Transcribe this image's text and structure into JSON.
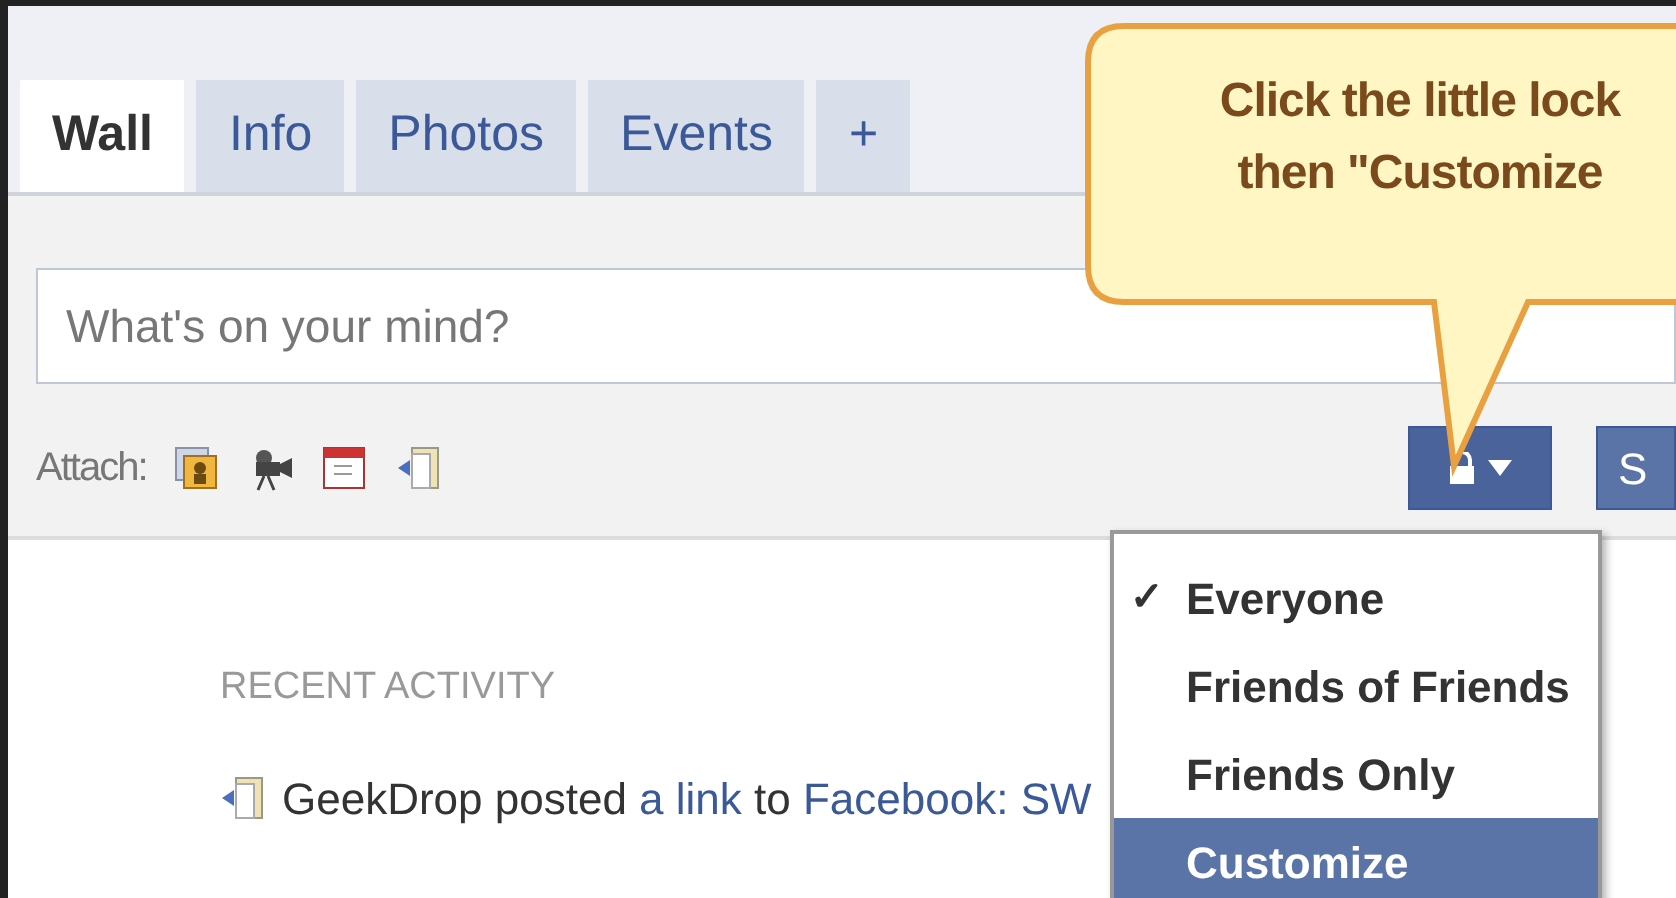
{
  "tabs": [
    {
      "label": "Wall",
      "selected": true
    },
    {
      "label": "Info",
      "selected": false
    },
    {
      "label": "Photos",
      "selected": false
    },
    {
      "label": "Events",
      "selected": false
    },
    {
      "label": "+",
      "selected": false
    }
  ],
  "composer": {
    "placeholder": "What's on your mind?",
    "attach_label": "Attach:",
    "privacy_button": {
      "expanded": true
    },
    "share_button": "S"
  },
  "callout": {
    "lines": [
      "Click the little lock",
      "then \"Customize"
    ]
  },
  "privacy_menu": [
    {
      "label": "Everyone",
      "checked": true,
      "selected": false
    },
    {
      "label": "Friends of Friends",
      "checked": false,
      "selected": false
    },
    {
      "label": "Friends Only",
      "checked": false,
      "selected": false
    },
    {
      "label": "Customize",
      "checked": false,
      "selected": true
    }
  ],
  "check_mark": "✓",
  "recent_activity": {
    "heading": "RECENT ACTIVITY",
    "items": [
      {
        "parts": [
          {
            "kind": "text",
            "text": "GeekDrop posted "
          },
          {
            "kind": "link",
            "text": "a link"
          },
          {
            "kind": "text",
            "text": " to "
          },
          {
            "kind": "link",
            "text": "Facebook: SW"
          }
        ]
      }
    ]
  }
}
